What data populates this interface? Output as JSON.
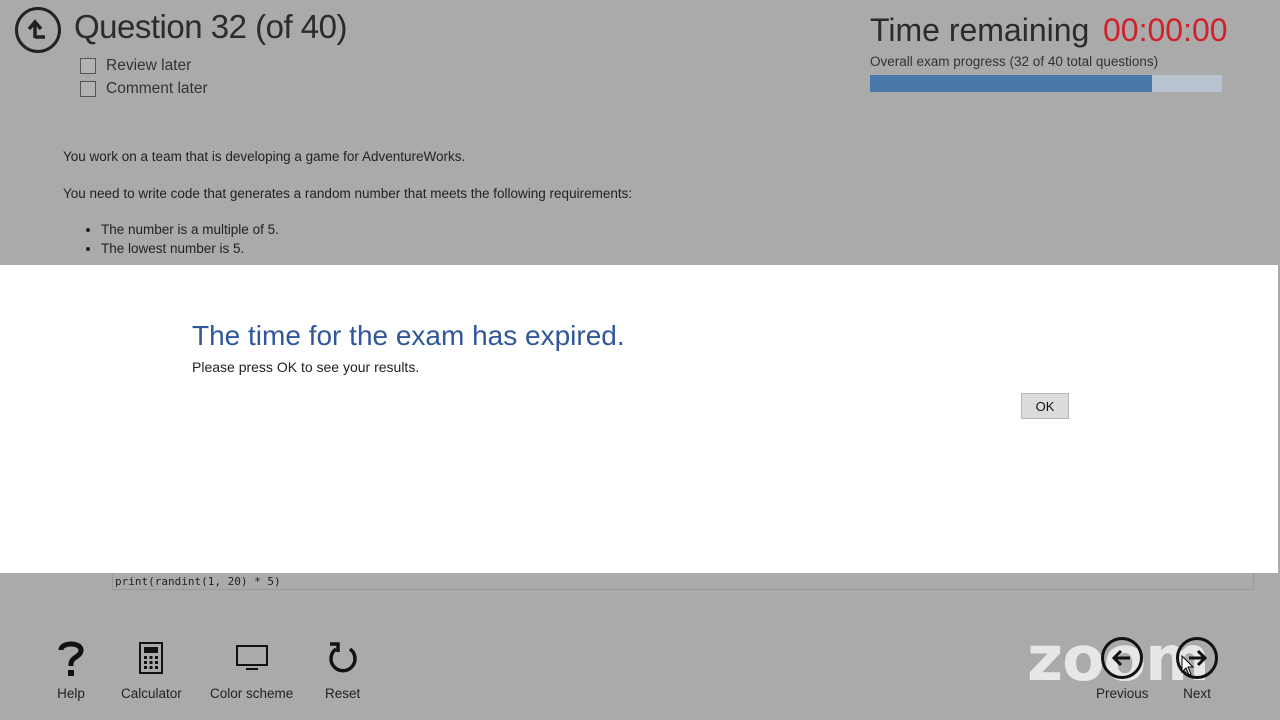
{
  "header": {
    "question_title": "Question 32 (of 40)",
    "review_label": "Review later",
    "comment_label": "Comment later",
    "time_label": "Time remaining",
    "time_value": "00:00:00",
    "progress_label": "Overall exam progress (32 of 40 total questions)",
    "progress_fraction": 0.8
  },
  "question": {
    "line1": "You work on a team that is developing a game for AdventureWorks.",
    "line2": "You need to write code that generates a random number that meets the following requirements:",
    "bullets": [
      "The number is a multiple of 5.",
      "The lowest number is 5."
    ],
    "code": "print(randint(1, 20) * 5)"
  },
  "modal": {
    "title": "The time for the exam has expired.",
    "message": "Please press OK to see your results.",
    "ok_label": "OK"
  },
  "toolbar": {
    "help": "Help",
    "calculator": "Calculator",
    "color_scheme": "Color scheme",
    "reset": "Reset",
    "previous": "Previous",
    "next": "Next"
  },
  "overlay": {
    "zoom_watermark": "zoom"
  },
  "colors": {
    "timer_red": "#d0202a",
    "progress_blue": "#4978a9",
    "modal_title_blue": "#30579a",
    "dimmed_background": "#aaaaaa"
  }
}
